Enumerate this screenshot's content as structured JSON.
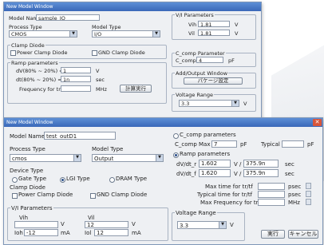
{
  "back_window": {
    "title": "New Model Window",
    "model_name_label": "Model Name",
    "model_name_value": "sample_IO",
    "process_type_label": "Process Type",
    "process_type_value": "CMOS",
    "model_type_label": "Model Type",
    "model_type_value": "I/O",
    "clamp_diode_title": "Clamp Diode",
    "power_clamp_label": "Power Clamp Diode",
    "gnd_clamp_label": "GND Clamp Diode",
    "ramp_title": "Ramp parameters",
    "dv_r_label": "dV(80% ~ 20%) =",
    "dv_r_value": "1",
    "dv_r_unit": "V",
    "dt_r_label": "dt(80% ~ 20%) =",
    "dt_r_value": "1n",
    "dt_r_unit": "sec",
    "freq_label": "Frequency for tr",
    "freq_unit": "MHz",
    "calc_button": "計算実行",
    "vi_title": "V/I Parameters",
    "vih_label": "Vih",
    "vih_value": "1.81",
    "vih_unit": "V",
    "vil_label": "Vil",
    "vil_value": "1.81",
    "vil_unit": "V",
    "comp_title": "C_comp Parameter",
    "ccomp_label": "C_comp",
    "ccomp_value": "4",
    "ccomp_unit": "pF",
    "pkg_title": "Add/Output Window",
    "pkg_button": "パケージ設定",
    "volt_title": "Voltage Range",
    "volt_value": "3.3",
    "volt_unit": "V"
  },
  "front_window": {
    "title": "New Model Window",
    "model_name_label": "Model Name",
    "model_name_value": "test_outD1",
    "process_type_label": "Process Type",
    "process_type_value": "cmos",
    "model_type_label": "Model Type",
    "model_type_value": "Output",
    "device_type_label": "Device Type",
    "device_types": [
      "Gate Type",
      "LGI Type",
      "DRAM Type"
    ],
    "clamp_diode_label": "Clamp Diode",
    "power_clamp_label": "Power Clamp Diode",
    "gnd_clamp_label": "GND Clamp Diode",
    "vi_title": "V/I Parameters",
    "vih_label": "Vih",
    "vih_unit": "V",
    "vil_label": "Vil",
    "vil_value": "12",
    "vil_unit": "V",
    "ioh_label": "Ioh",
    "ioh_value": "-12",
    "ioh_unit": "mA",
    "iol_label": "Iol",
    "iol_value": "12",
    "iol_unit": "mA",
    "ccomp_title": "C_comp parameters",
    "ccomp_max_label": "C_comp Max",
    "ccomp_max_value": "7",
    "ccomp_max_unit": "pF",
    "typical_label": "Typical",
    "typical_unit": "pF",
    "ramp_title": "Ramp parameters",
    "dv_dt_r_label": "dV/dt_r",
    "dv_dt_r_v": "1.602",
    "dv_dt_r_v_unit": "V /",
    "dv_dt_r_t": "375.9n",
    "dv_dt_r_t_unit": "sec",
    "dv_dt_f_label": "dV/dt_f",
    "dv_dt_f_v": "1.620",
    "dv_dt_f_v_unit": "V /",
    "dv_dt_f_t": "375.9n",
    "dv_dt_f_t_unit": "sec",
    "max_time_label": "Max time for tr/tf",
    "max_time_unit": "psec",
    "typ_time_label": "Typical time for tr/tf",
    "typ_time_unit": "psec",
    "max_freq_label": "Max Frequency for tr",
    "max_freq_unit": "MHz",
    "volt_title": "Voltage Range",
    "volt_value": "3.3",
    "volt_unit": "V",
    "ok_button": "実行",
    "cancel_button": "キャンセル"
  }
}
